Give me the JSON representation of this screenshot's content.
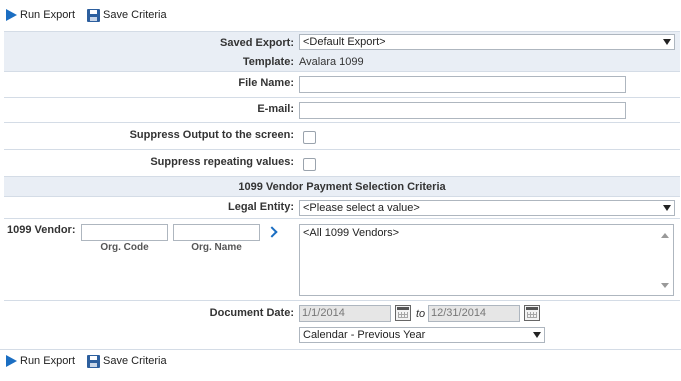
{
  "toolbar": {
    "run_export": "Run Export",
    "save_criteria": "Save Criteria"
  },
  "form": {
    "saved_export": {
      "label": "Saved Export:",
      "value": "<Default Export>"
    },
    "template": {
      "label": "Template:",
      "value": "Avalara 1099"
    },
    "file_name": {
      "label": "File Name:",
      "value": ""
    },
    "email": {
      "label": "E-mail:",
      "value": ""
    },
    "suppress_output": {
      "label": "Suppress Output to the screen:",
      "checked": false
    },
    "suppress_repeating": {
      "label": "Suppress repeating values:",
      "checked": false
    }
  },
  "section": {
    "title": "1099 Vendor Payment Selection Criteria",
    "legal_entity": {
      "label": "Legal Entity:",
      "value": "<Please select a value>"
    },
    "vendor": {
      "label": "1099 Vendor:",
      "org_code_label": "Org. Code",
      "org_name_label": "Org. Name",
      "list_items": [
        "<All 1099 Vendors>"
      ]
    },
    "document_date": {
      "label": "Document Date:",
      "from": "1/1/2014",
      "to_label": "to",
      "to": "12/31/2014",
      "range": "Calendar - Previous Year"
    }
  }
}
